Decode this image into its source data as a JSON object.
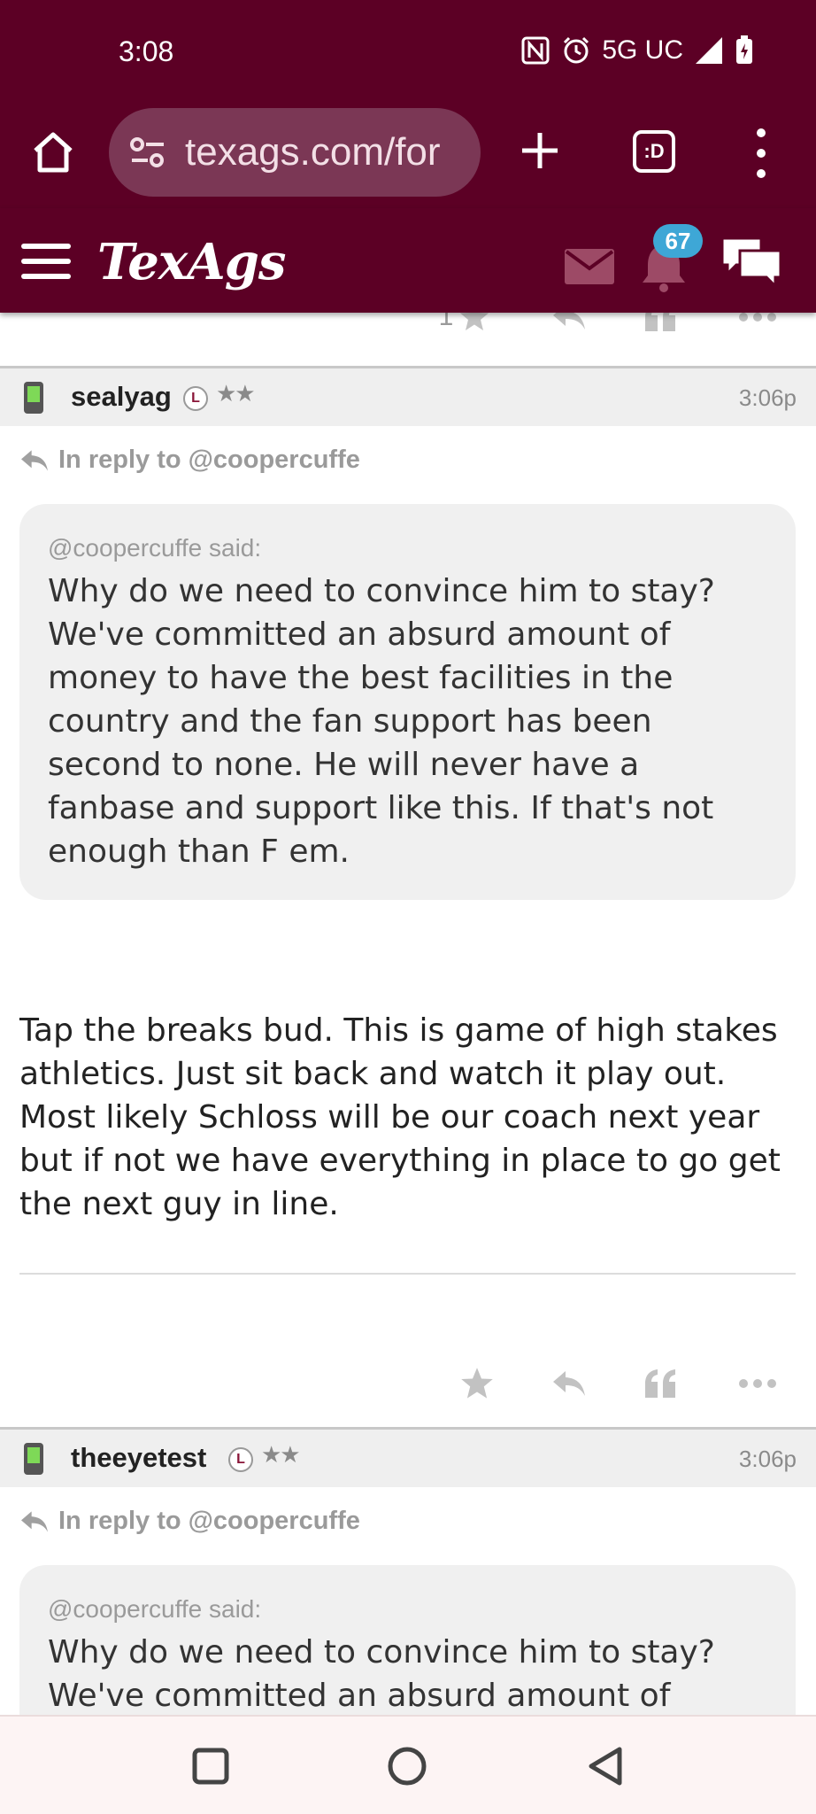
{
  "status_bar": {
    "time": "3:08",
    "network": "5G UC",
    "icons": [
      "nfc-icon",
      "alarm-icon",
      "data-arrows-icon",
      "signal-icon",
      "battery-charging-icon"
    ]
  },
  "browser": {
    "url": "texags.com/for",
    "tab_switcher_label": ":D",
    "icons": [
      "home-icon",
      "site-settings-icon",
      "plus-icon",
      "tab-switcher-icon",
      "more-vert-icon"
    ]
  },
  "site_header": {
    "logo": "TexAgs",
    "notification_count": "67",
    "icons": [
      "hamburger-icon",
      "mail-icon",
      "bell-icon",
      "chat-icon"
    ]
  },
  "posts": [
    {
      "star_count": "1"
    },
    {
      "username": "sealyag",
      "badge": "L",
      "stars": "★★",
      "time": "3:06p",
      "reply_to": "In reply to @coopercuffe",
      "quote_said": "@coopercuffe said:",
      "quote_text": "Why do we need to convince him to stay? We've committed an absurd amount of money to have the best facilities in the country and the fan support has been second to none. He will never have a fanbase and support like this. If that's not enough than F em.",
      "body": "Tap the breaks bud. This is game of high stakes athletics. Just sit back and watch it play out. Most likely Schloss will be our coach next year but if not we have everything in place to go get the next guy in line."
    },
    {
      "username": "theeyetest",
      "badge": "L",
      "stars": "★★",
      "time": "3:06p",
      "reply_to": "In reply to @coopercuffe",
      "quote_said": "@coopercuffe said:",
      "quote_text": "Why do we need to convince him to stay? We've committed an absurd amount of"
    }
  ],
  "colors": {
    "maroon": "#5c0025",
    "badge_blue": "#3ea7d6",
    "muted_gray": "#9a9a9a",
    "quote_bg": "#f0f0f0"
  },
  "nav_bar": {
    "icons": [
      "recents-square-icon",
      "home-circle-icon",
      "back-triangle-icon"
    ]
  }
}
